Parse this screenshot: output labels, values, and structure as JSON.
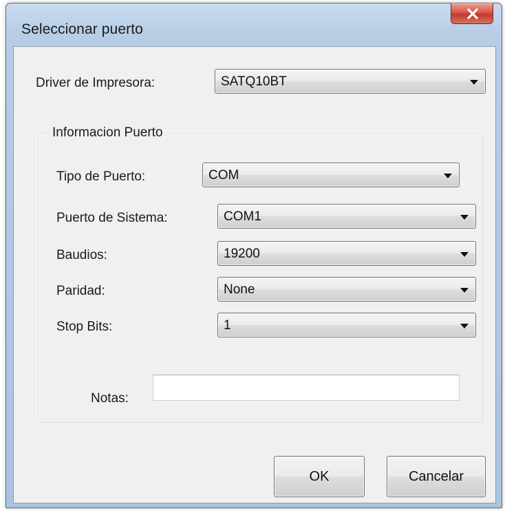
{
  "window": {
    "title": "Seleccionar puerto"
  },
  "driver": {
    "label": "Driver de Impresora:",
    "value": "SATQ10BT"
  },
  "port_info": {
    "legend": "Informacion Puerto",
    "port_type": {
      "label": "Tipo  de Puerto:",
      "value": "COM"
    },
    "system_port": {
      "label": "Puerto de Sistema:",
      "value": "COM1"
    },
    "baud": {
      "label": "Baudios:",
      "value": "19200"
    },
    "parity": {
      "label": "Paridad:",
      "value": "None"
    },
    "stop_bits": {
      "label": "Stop Bits:",
      "value": "1"
    },
    "notes": {
      "label": "Notas:",
      "value": ""
    }
  },
  "buttons": {
    "ok": "OK",
    "cancel": "Cancelar"
  },
  "icons": {
    "close": "close-icon",
    "dropdown": "chevron-down-icon"
  },
  "colors": {
    "close_button": "#c23a2a",
    "titlebar": "#b7cde6",
    "client_bg": "#f0f0f0"
  }
}
